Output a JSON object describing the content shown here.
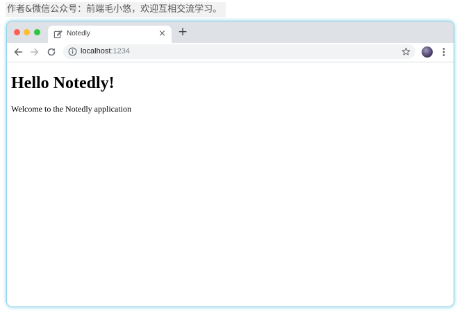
{
  "caption": {
    "text": "作者&微信公众号：前端毛小悠，欢迎互相交流学习。"
  },
  "browser": {
    "tab": {
      "title": "Notedly",
      "icon": "edit-icon",
      "close_symbol": "×"
    },
    "new_tab_symbol": "+",
    "address": {
      "host": "localhost",
      "port": ":1234"
    },
    "traffic_lights": [
      "#fe5f57",
      "#febc2e",
      "#28c840"
    ],
    "accent_glow": "#8fd3ea"
  },
  "page": {
    "heading": "Hello Notedly!",
    "paragraph": "Welcome to the Notedly application"
  }
}
